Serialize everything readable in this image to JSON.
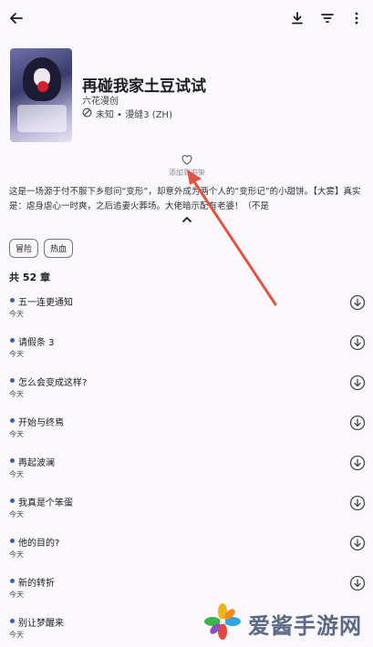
{
  "manga": {
    "title": "再碰我家土豆试试",
    "author": "六花漫创",
    "status_source": "未知 • 漫缝3 (ZH)"
  },
  "favorite": {
    "label": "添加到书架"
  },
  "description": "这是一场源于付不服下乡慰问“变形”，却意外成为两个人的“变形记”的小甜饼。【大雾】真实是：虐身虐心一时爽，之后追妻火葬场。大佬暗示配有老婆！（不是",
  "tags": [
    "冒险",
    "热血"
  ],
  "chapter_count": "共 52 章",
  "chapters": [
    {
      "name": "五一连更通知",
      "date": "今天"
    },
    {
      "name": "请假条 3",
      "date": "今天"
    },
    {
      "name": "怎么会变成这样?",
      "date": "今天"
    },
    {
      "name": "开始与终焉",
      "date": "今天"
    },
    {
      "name": "再起波澜",
      "date": "今天"
    },
    {
      "name": "我真是个笨蛋",
      "date": "今天"
    },
    {
      "name": "他的目的?",
      "date": "今天"
    },
    {
      "name": "新的转折",
      "date": "今天"
    },
    {
      "name": "别让梦醒来",
      "date": "今天"
    }
  ],
  "watermark": {
    "text": "爱酱手游网"
  },
  "icons": {
    "back": "arrow-left-icon",
    "download": "download-icon",
    "filter": "filter-icon",
    "more": "more-vert-icon",
    "status": "block-icon",
    "favorite": "heart-outline-icon",
    "expand": "chevron-up-icon",
    "chapter_download": "download-circle-icon"
  },
  "colors": {
    "background": "#fbf8fd",
    "unread_dot": "#3c5eb0",
    "annotation_arrow": "#e0553f"
  }
}
